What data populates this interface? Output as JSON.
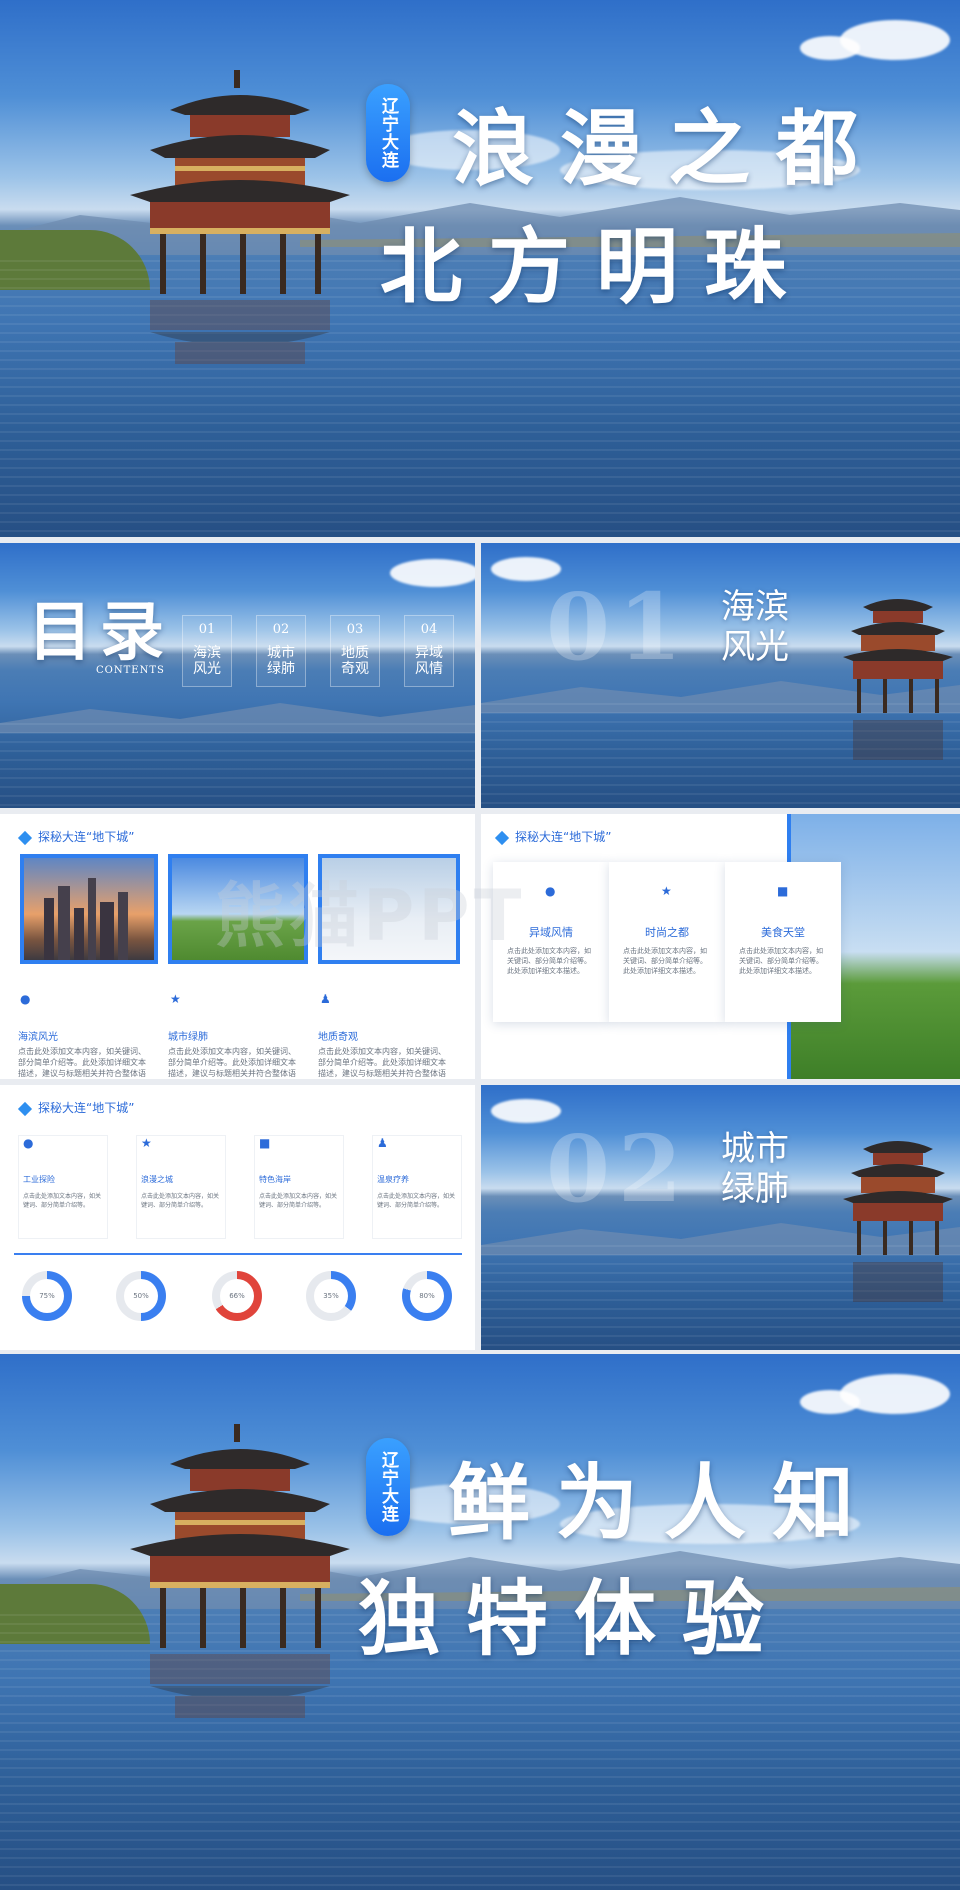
{
  "hero": {
    "badge": "辽宁大连",
    "line1": "浪漫之都",
    "line2": "北方明珠"
  },
  "toc": {
    "title": "目录",
    "subtitle": "CONTENTS",
    "items": [
      {
        "num": "01",
        "label": "海滨风光"
      },
      {
        "num": "02",
        "label": "城市绿肺"
      },
      {
        "num": "03",
        "label": "地质奇观"
      },
      {
        "num": "04",
        "label": "异域风情"
      }
    ]
  },
  "section1": {
    "num": "01",
    "title": "海滨风光"
  },
  "section2": {
    "num": "02",
    "title": "城市绿肺"
  },
  "slide_a": {
    "header": "探秘大连“地下城”",
    "items": [
      {
        "title": "海滨风光",
        "text": "点击此处添加文本内容，如关键词、部分简单介绍等。此处添加详细文本描述，建议与标题相关并符合整体语言风格。"
      },
      {
        "title": "城市绿肺",
        "text": "点击此处添加文本内容，如关键词、部分简单介绍等。此处添加详细文本描述，建议与标题相关并符合整体语言风格。"
      },
      {
        "title": "地质奇观",
        "text": "点击此处添加文本内容，如关键词、部分简单介绍等。此处添加详细文本描述，建议与标题相关并符合整体语言风格。"
      }
    ]
  },
  "slide_b": {
    "header": "探秘大连“地下城”",
    "cards": [
      {
        "title": "异域风情",
        "text": "点击此处添加文本内容，如关键词、部分简单介绍等。此处添加详细文本描述。"
      },
      {
        "title": "时尚之都",
        "text": "点击此处添加文本内容，如关键词、部分简单介绍等。此处添加详细文本描述。"
      },
      {
        "title": "美食天堂",
        "text": "点击此处添加文本内容，如关键词、部分简单介绍等。此处添加详细文本描述。"
      }
    ]
  },
  "slide_c": {
    "header": "探秘大连“地下城”",
    "columns": [
      {
        "title": "工业探险",
        "text": "点击此处添加文本内容，如关键词、部分简单介绍等。"
      },
      {
        "title": "浪漫之城",
        "text": "点击此处添加文本内容，如关键词、部分简单介绍等。"
      },
      {
        "title": "特色海岸",
        "text": "点击此处添加文本内容，如关键词、部分简单介绍等。"
      },
      {
        "title": "温泉疗养",
        "text": "点击此处添加文本内容，如关键词、部分简单介绍等。"
      }
    ],
    "rings": [
      {
        "label": "75%",
        "value": 0.75,
        "color": "#3a7ff0"
      },
      {
        "label": "50%",
        "value": 0.5,
        "color": "#3a7ff0"
      },
      {
        "label": "66%",
        "value": 0.66,
        "color": "#e0443b"
      },
      {
        "label": "35%",
        "value": 0.35,
        "color": "#3a7ff0"
      },
      {
        "label": "80%",
        "value": 0.8,
        "color": "#3a7ff0"
      }
    ]
  },
  "closing": {
    "badge": "辽宁大连",
    "line1": "鲜为人知",
    "line2": "独特体验"
  },
  "watermark": "熊猫PPT"
}
